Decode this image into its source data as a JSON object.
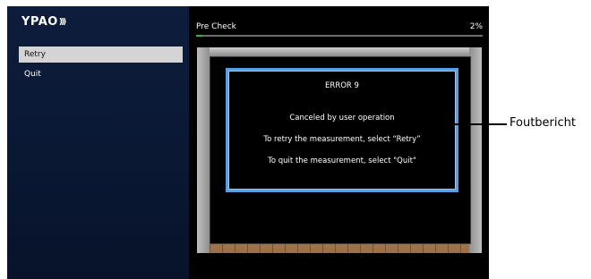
{
  "logo": {
    "text": "YPAO",
    "waves": ")))"
  },
  "menu": {
    "items": [
      {
        "label": "Retry",
        "selected": true
      },
      {
        "label": "Quit",
        "selected": false
      }
    ]
  },
  "header": {
    "title": "Pre Check",
    "progress_label": "2%",
    "progress": 0.02
  },
  "dialog": {
    "title": "ERROR 9",
    "message": "Canceled by user operation",
    "retry_hint": "To retry the measurement, select “Retry”",
    "quit_hint": "To quit the measurement, select \"Quit\""
  },
  "callout": {
    "label": "Foutbericht"
  },
  "colors": {
    "accent": "#5aa0e0",
    "progress": "#2fbf3b",
    "sidebar": "#0d1d3b"
  }
}
